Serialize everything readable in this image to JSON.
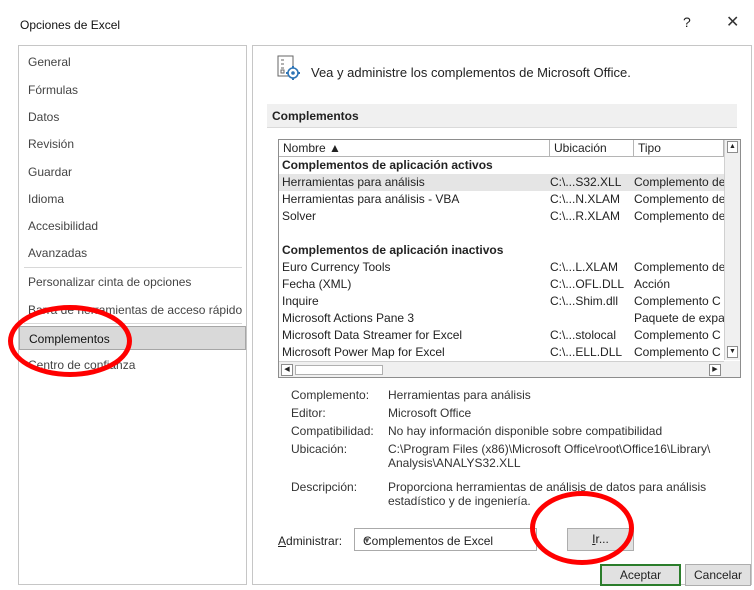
{
  "window": {
    "title": "Opciones de Excel",
    "help_glyph": "?",
    "close_glyph": "✕"
  },
  "sidebar": {
    "items": [
      {
        "label": "General"
      },
      {
        "label": "Fórmulas"
      },
      {
        "label": "Datos"
      },
      {
        "label": "Revisión"
      },
      {
        "label": "Guardar"
      },
      {
        "label": "Idioma"
      },
      {
        "label": "Accesibilidad"
      },
      {
        "label": "Avanzadas"
      },
      {
        "label": "Personalizar cinta de opciones"
      },
      {
        "label": "Barra de herramientas de acceso rápido"
      },
      {
        "label": "Complementos",
        "selected": true
      },
      {
        "label": "Centro de confianza"
      }
    ]
  },
  "content": {
    "header_text": "Vea y administre los complementos de Microsoft Office.",
    "section_title": "Complementos",
    "table": {
      "columns": [
        "Nombre ▲",
        "Ubicación",
        "Tipo"
      ],
      "rows": [
        {
          "group": "Complementos de aplicación activos"
        },
        {
          "name": "Herramientas para análisis",
          "location": "C:\\...S32.XLL",
          "type": "Complemento de",
          "selected": true
        },
        {
          "name": "Herramientas para análisis - VBA",
          "location": "C:\\...N.XLAM",
          "type": "Complemento de"
        },
        {
          "name": "Solver",
          "location": "C:\\...R.XLAM",
          "type": "Complemento de"
        },
        {
          "spacer": true
        },
        {
          "group": "Complementos de aplicación inactivos"
        },
        {
          "name": "Euro Currency Tools",
          "location": "C:\\...L.XLAM",
          "type": "Complemento de"
        },
        {
          "name": "Fecha (XML)",
          "location": "C:\\...OFL.DLL",
          "type": "Acción"
        },
        {
          "name": "Inquire",
          "location": "C:\\...Shim.dll",
          "type": "Complemento C"
        },
        {
          "name": "Microsoft Actions Pane 3",
          "location": "",
          "type": "Paquete de expan"
        },
        {
          "name": "Microsoft Data Streamer for Excel",
          "location": "C:\\...stolocal",
          "type": "Complemento C"
        },
        {
          "name": "Microsoft Power Map for Excel",
          "location": "C:\\...ELL.DLL",
          "type": "Complemento C"
        }
      ]
    },
    "details": {
      "addin_label": "Complemento:",
      "addin_value": "Herramientas para análisis",
      "editor_label": "Editor:",
      "editor_value": "Microsoft Office",
      "compat_label": "Compatibilidad:",
      "compat_value": "No hay información disponible sobre compatibilidad",
      "location_label": "Ubicación:",
      "location_value_1": "C:\\Program Files (x86)\\Microsoft Office\\root\\Office16\\Library\\",
      "location_value_2": "Analysis\\ANALYS32.XLL",
      "desc_label": "Descripción:",
      "desc_value_1": "Proporciona herramientas de análisis de datos para análisis",
      "desc_value_2": "estadístico y de ingeniería."
    },
    "manage": {
      "label_prefix": "A",
      "label_rest": "dministrar:",
      "selected": "Complementos de Excel",
      "go_prefix": "I",
      "go_rest": "r..."
    }
  },
  "footer": {
    "ok": "Aceptar",
    "cancel": "Cancelar"
  },
  "annotation_color": "#ff0000"
}
